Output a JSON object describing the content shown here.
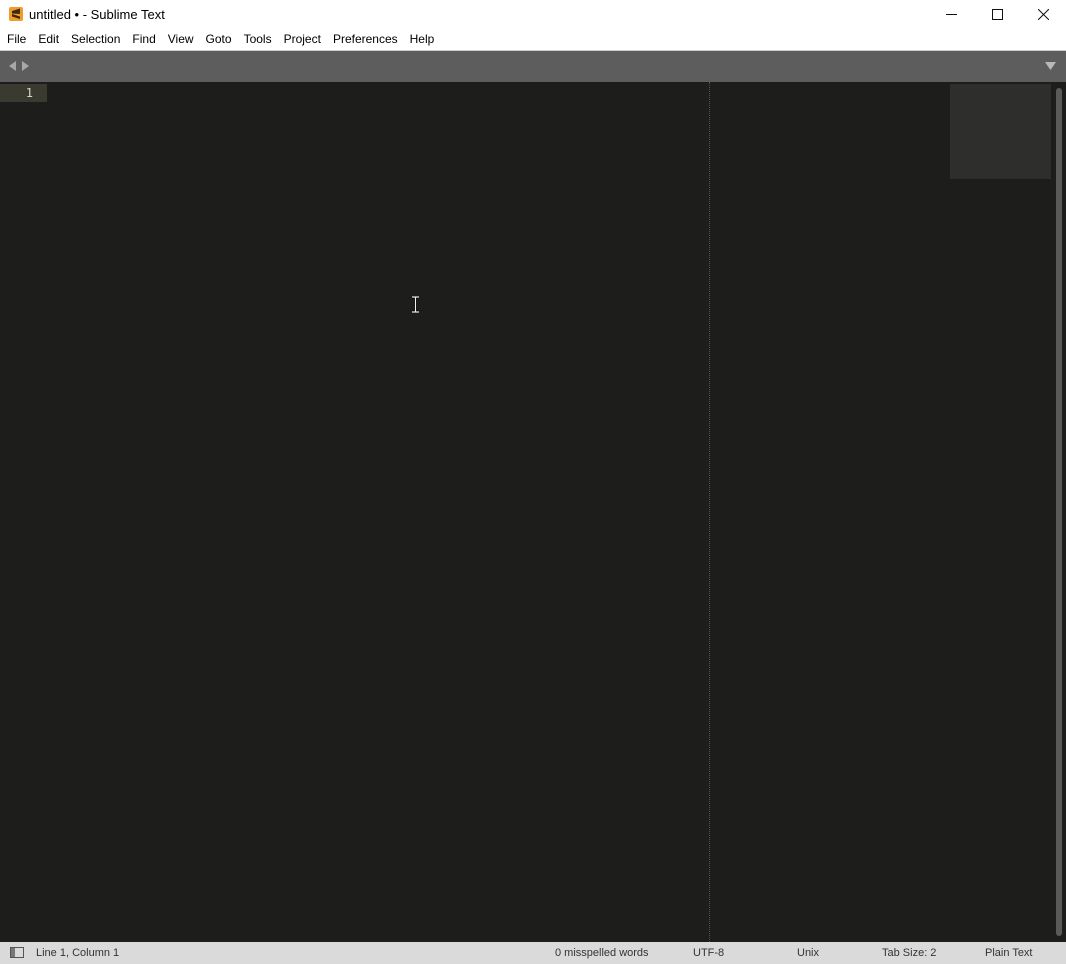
{
  "window": {
    "title": "untitled • - Sublime Text",
    "app_icon": "sublime-text-icon",
    "controls": [
      "minimize-icon",
      "maximize-icon",
      "close-icon"
    ]
  },
  "menu": {
    "items": [
      "File",
      "Edit",
      "Selection",
      "Find",
      "View",
      "Goto",
      "Tools",
      "Project",
      "Preferences",
      "Help"
    ]
  },
  "tabs": {
    "nav": [
      "tab-back-icon",
      "tab-forward-icon"
    ],
    "overflow": "tab-list-dropdown-icon"
  },
  "editor": {
    "current_line_number": "1",
    "content": "",
    "colors": {
      "background": "#1d1d1b",
      "gutter_highlight": "#3a3a30",
      "tab_strip": "#5d5d5d",
      "status_bar": "#dadada"
    }
  },
  "status": {
    "position": "Line 1, Column 1",
    "spelling": "0 misspelled words",
    "encoding": "UTF-8",
    "line_endings": "Unix",
    "indentation": "Tab Size: 2",
    "syntax": "Plain Text"
  }
}
